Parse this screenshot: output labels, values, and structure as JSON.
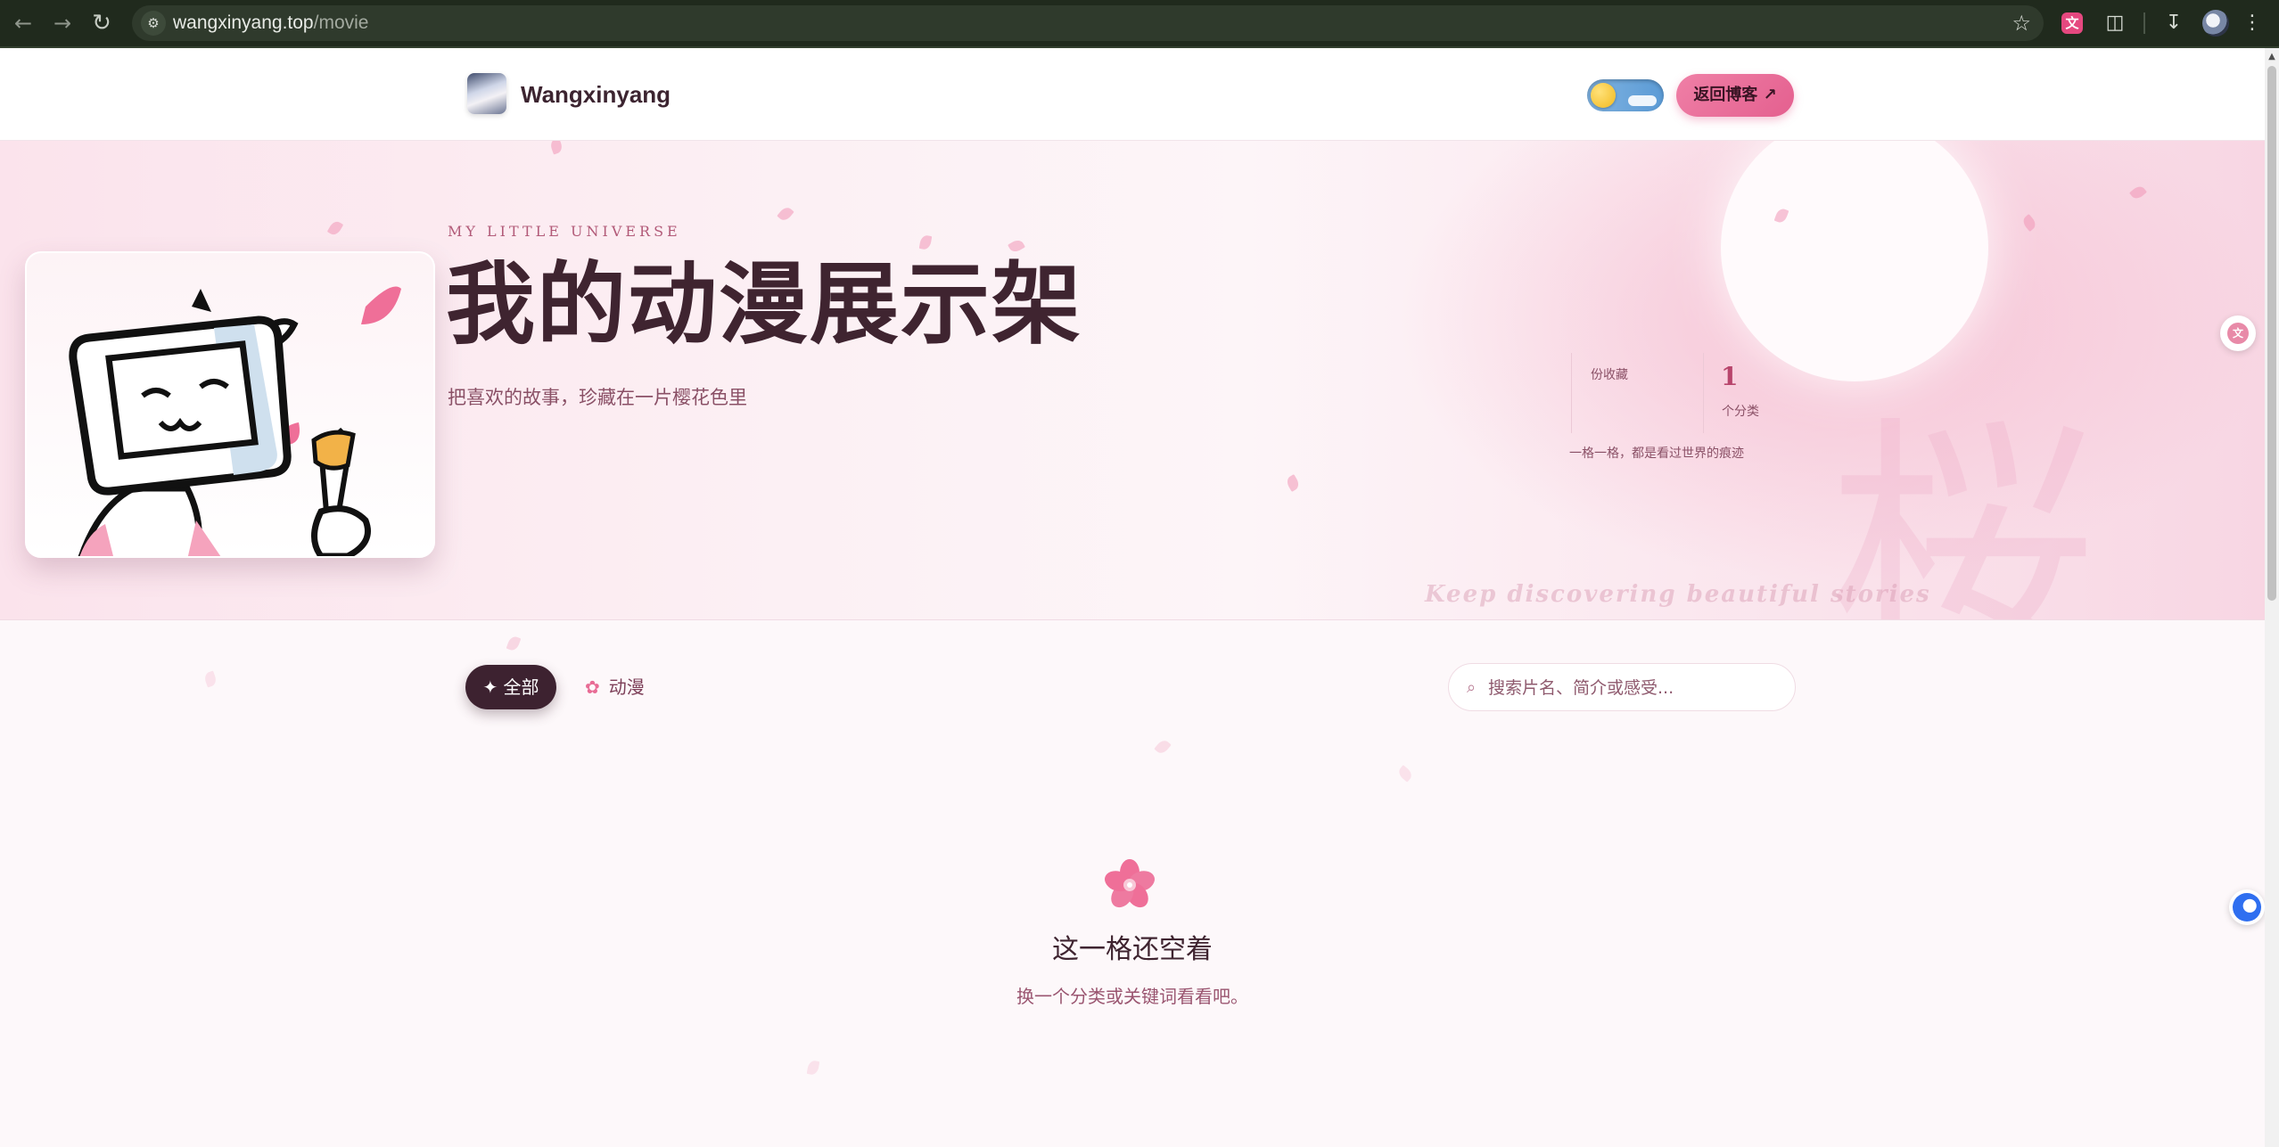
{
  "browser": {
    "url_host": "wangxinyang.top",
    "url_path": "/movie"
  },
  "header": {
    "site_name": "Wangxinyang",
    "back_button": "返回博客 ↗"
  },
  "hero": {
    "eyebrow": "MY LITTLE UNIVERSE",
    "title": "我的动漫展示架",
    "subtitle": "把喜欢的故事，珍藏在一片樱花色里",
    "stats": {
      "collection_label": "份收藏",
      "category_count": "1",
      "category_label": "个分类",
      "note": "一格一格，都是看过世界的痕迹"
    },
    "script_text": "Keep discovering beautiful stories",
    "kanji": "桜"
  },
  "filters": {
    "all_label": "✦ 全部",
    "anime_label": "动漫",
    "search_placeholder": "搜索片名、简介或感受..."
  },
  "empty_state": {
    "title": "这一格还空着",
    "subtitle": "换一个分类或关键词看看吧。"
  },
  "colors": {
    "accent": "#e4608f",
    "dark": "#3d2230",
    "chrome_bg": "#202a1d"
  }
}
